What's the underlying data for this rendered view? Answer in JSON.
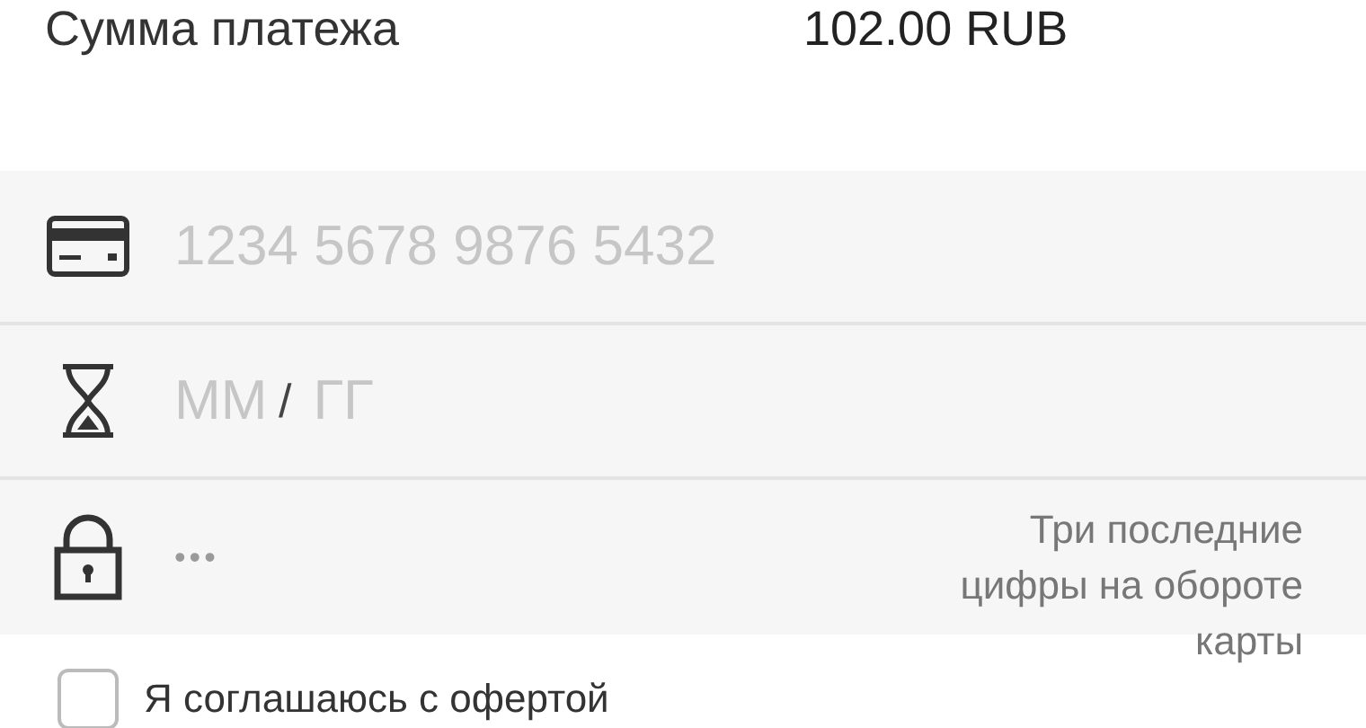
{
  "payment": {
    "label": "Сумма платежа",
    "amount": "102.00 RUB"
  },
  "fields": [
    {
      "kind": "card",
      "placeholder": "1234 5678 9876 5432"
    },
    {
      "kind": "expiry",
      "month_placeholder": "ММ",
      "separator": "/",
      "year_placeholder": "ГГ"
    },
    {
      "kind": "cvc",
      "placeholder": "•••",
      "hint": "Три последние цифры на обороте карты"
    }
  ],
  "agreement": {
    "label": "Я соглашаюсь с офертой",
    "checked": false
  }
}
